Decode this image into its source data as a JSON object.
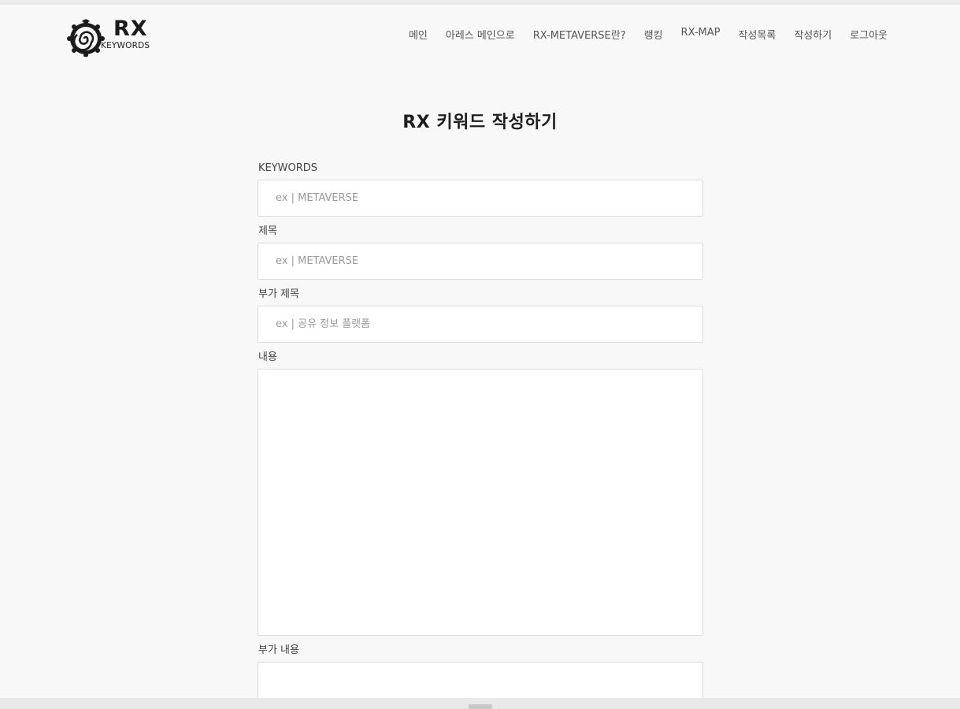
{
  "header": {
    "logo": {
      "title": "RX",
      "subtitle": "KEYWORDS"
    },
    "nav": [
      "메인",
      "아레스 메인으로",
      "RX-METAVERSE란?",
      "랭킹",
      "RX-MAP",
      "작성목록",
      "작성하기",
      "로그아웃"
    ]
  },
  "page": {
    "title": "RX 키워드 작성하기"
  },
  "form": {
    "keywords": {
      "label": "KEYWORDS",
      "placeholder": "ex | METAVERSE",
      "value": ""
    },
    "title": {
      "label": "제목",
      "placeholder": "ex | METAVERSE",
      "value": ""
    },
    "subtitle": {
      "label": "부가 제목",
      "placeholder": "ex | 공유 정보 플랫폼",
      "value": ""
    },
    "content": {
      "label": "내용",
      "value": ""
    },
    "extra_content": {
      "label": "부가 내용",
      "value": ""
    }
  },
  "colors": {
    "background": "#f8f8f8",
    "input_border": "#dcdcdc",
    "nav_text": "#555555",
    "title_text": "#1d1d1d"
  }
}
